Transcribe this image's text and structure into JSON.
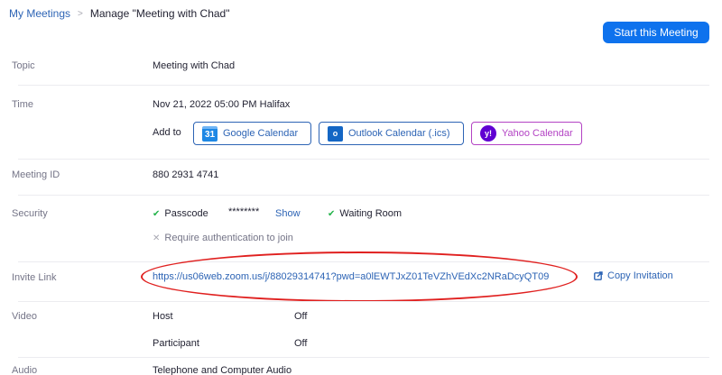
{
  "breadcrumb": {
    "parent": "My Meetings",
    "separator": ">",
    "current": "Manage \"Meeting with Chad\""
  },
  "actions": {
    "start_label": "Start this Meeting"
  },
  "topic": {
    "label": "Topic",
    "value": "Meeting with Chad"
  },
  "time": {
    "label": "Time",
    "value": "Nov 21, 2022 05:00 PM Halifax",
    "add_to_label": "Add to",
    "calendars": [
      {
        "label": "Google Calendar",
        "icon": "google-calendar-icon",
        "icon_text": "31"
      },
      {
        "label": "Outlook Calendar (.ics)",
        "icon": "outlook-icon",
        "icon_text": "o"
      },
      {
        "label": "Yahoo Calendar",
        "icon": "yahoo-icon",
        "icon_text": "y!"
      }
    ]
  },
  "meeting_id": {
    "label": "Meeting ID",
    "value": "880 2931 4741"
  },
  "security": {
    "label": "Security",
    "passcode_label": "Passcode",
    "passcode_masked": "********",
    "show_label": "Show",
    "waiting_room_label": "Waiting Room",
    "auth_label": "Require authentication to join"
  },
  "invite": {
    "label": "Invite Link",
    "url": "https://us06web.zoom.us/j/88029314741?pwd=a0lEWTJxZ01TeVZhVEdXc2NRaDcyQT09",
    "copy_label": "Copy Invitation"
  },
  "video": {
    "label": "Video",
    "host_label": "Host",
    "host_value": "Off",
    "participant_label": "Participant",
    "participant_value": "Off"
  },
  "audio": {
    "label": "Audio",
    "value": "Telephone and Computer Audio"
  },
  "colors": {
    "primary": "#0e72ed",
    "link": "#2d64b5",
    "yahoo": "#b343c4",
    "highlight": "#e0201f",
    "check": "#23b34a"
  }
}
